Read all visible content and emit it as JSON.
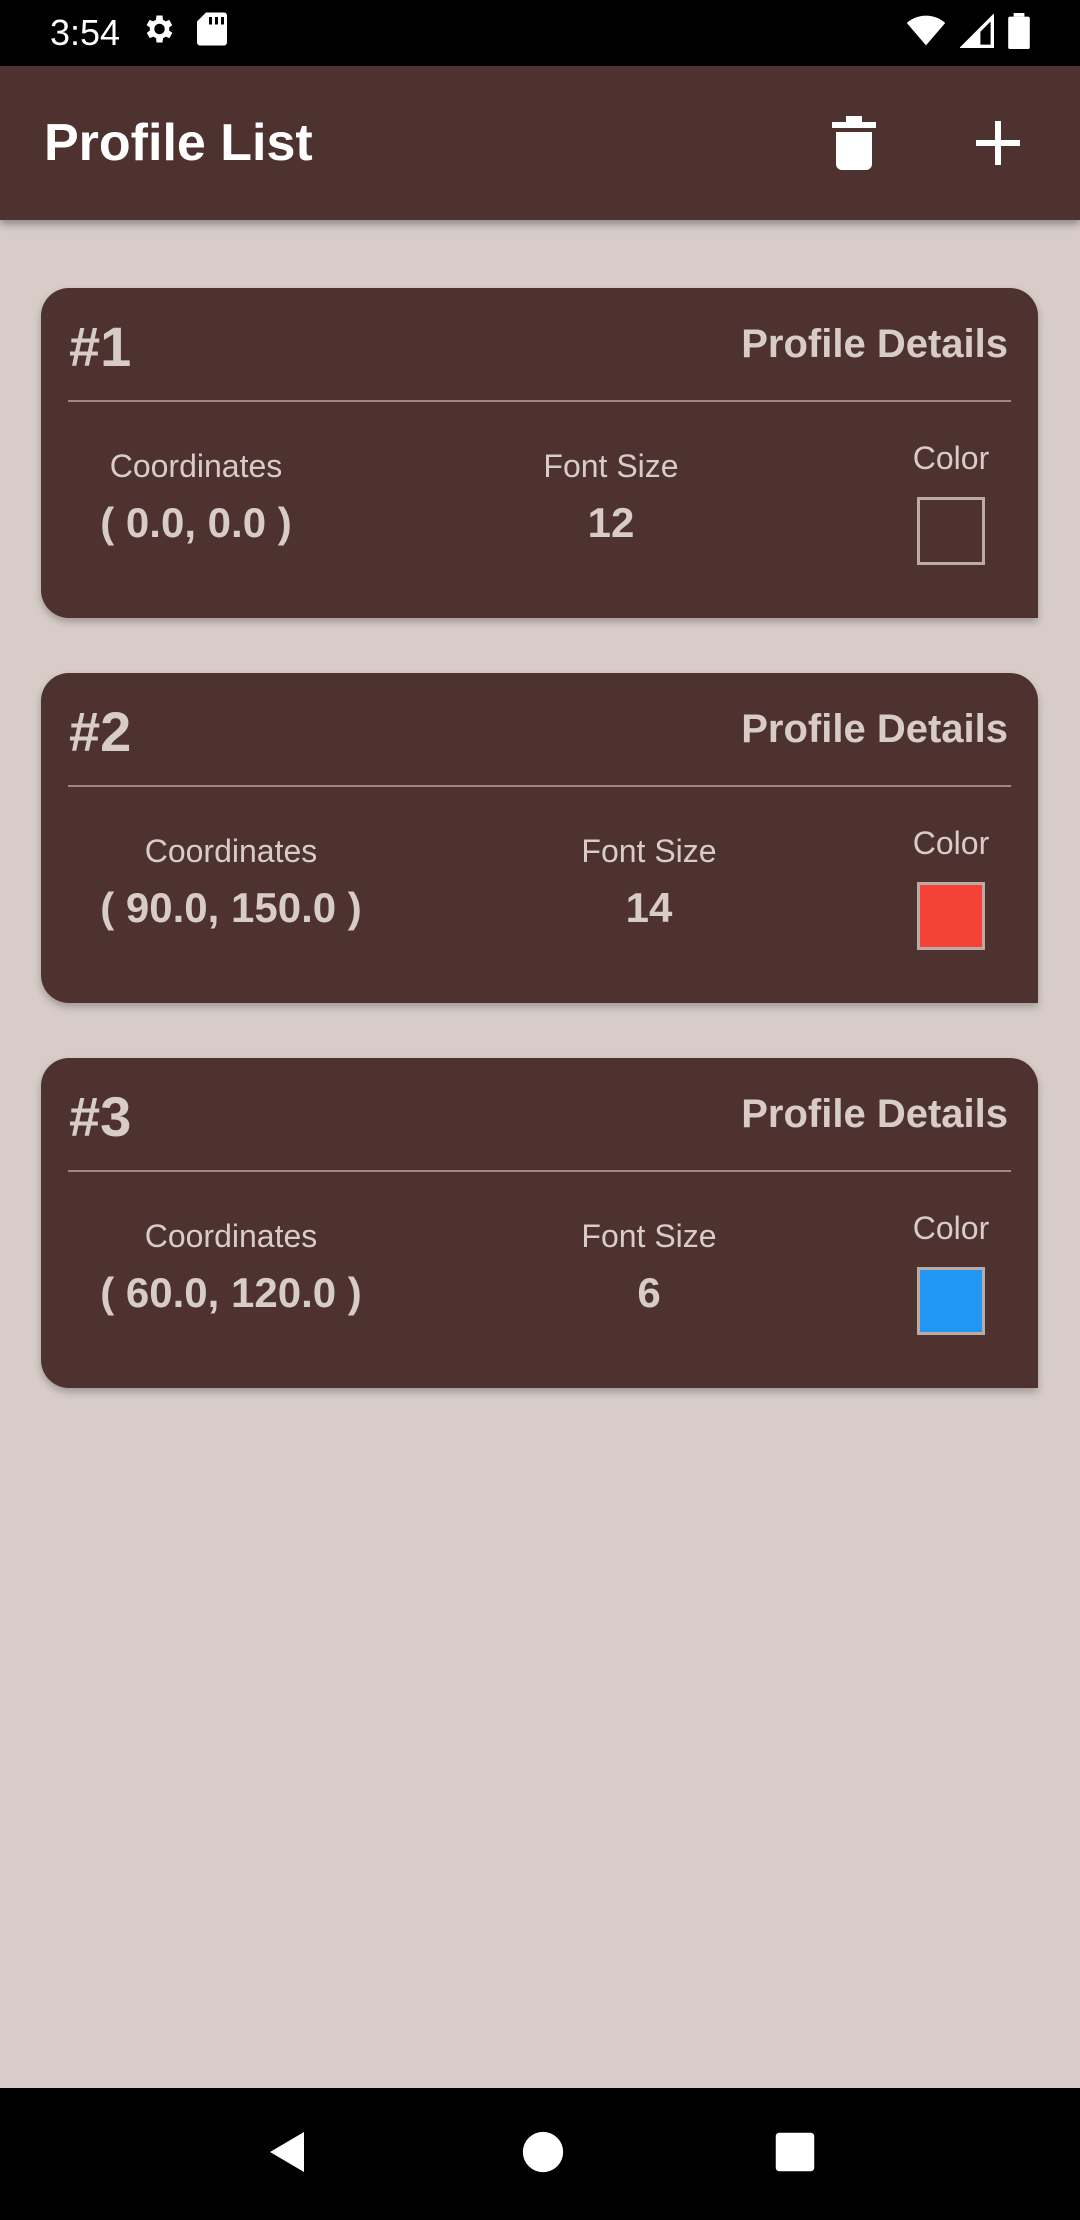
{
  "status_bar": {
    "time": "3:54"
  },
  "app_bar": {
    "title": "Profile List"
  },
  "profiles": [
    {
      "number": "#1",
      "details_label": "Profile Details",
      "coordinates_label": "Coordinates",
      "coordinates": "( 0.0, 0.0 )",
      "font_size_label": "Font Size",
      "font_size": "12",
      "color_label": "Color",
      "color": "transparent"
    },
    {
      "number": "#2",
      "details_label": "Profile Details",
      "coordinates_label": "Coordinates",
      "coordinates": "( 90.0, 150.0 )",
      "font_size_label": "Font Size",
      "font_size": "14",
      "color_label": "Color",
      "color": "#f44336"
    },
    {
      "number": "#3",
      "details_label": "Profile Details",
      "coordinates_label": "Coordinates",
      "coordinates": "( 60.0, 120.0 )",
      "font_size_label": "Font Size",
      "font_size": "6",
      "color_label": "Color",
      "color": "#2196f3"
    }
  ]
}
